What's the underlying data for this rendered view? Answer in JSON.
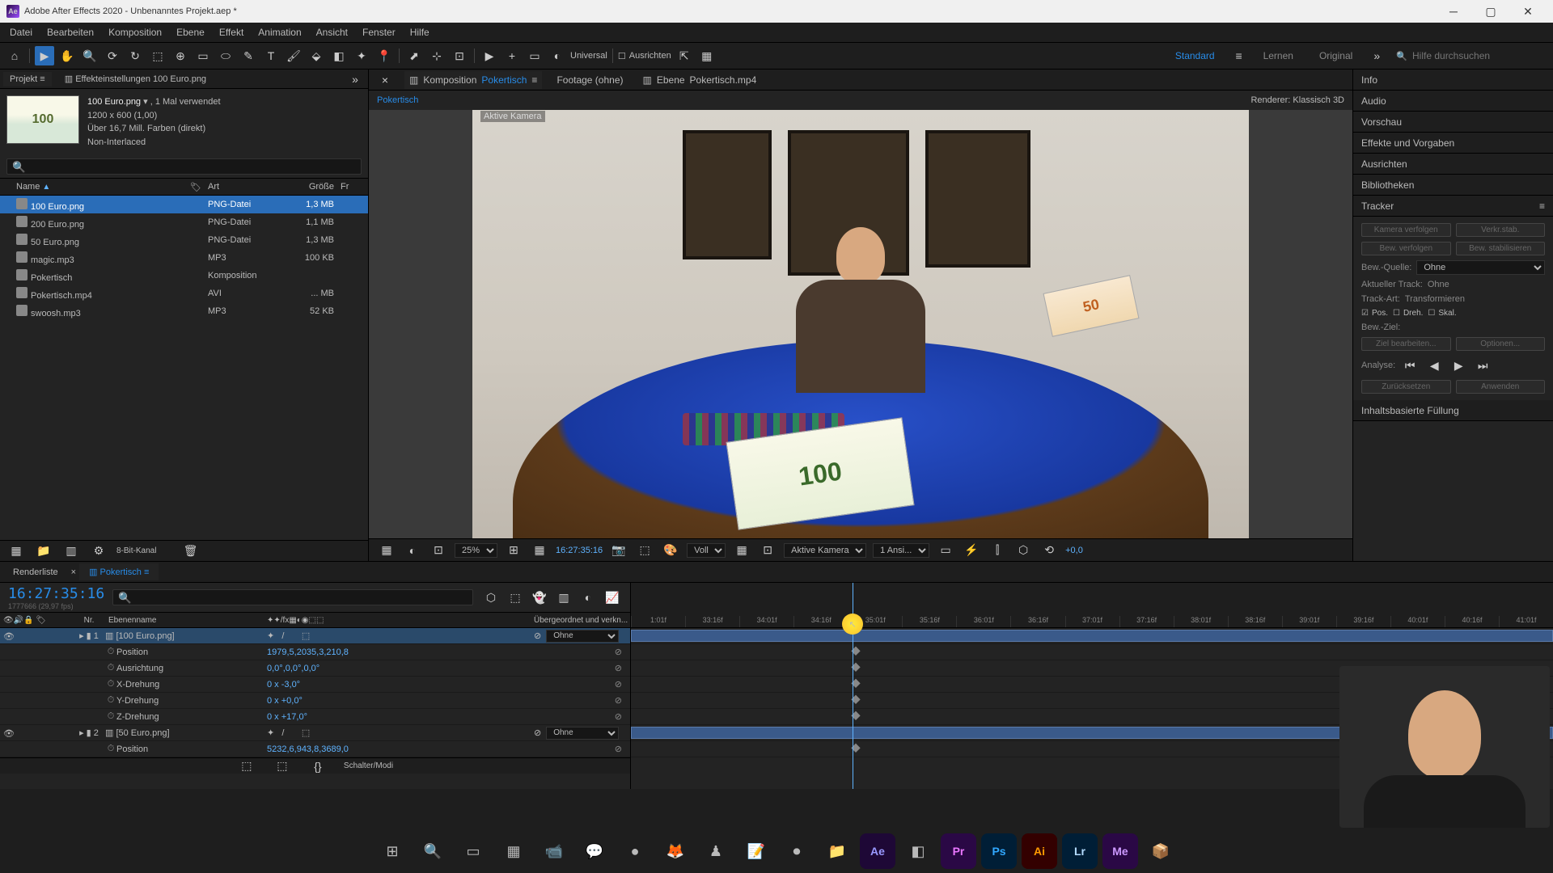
{
  "titlebar": {
    "app_icon": "Ae",
    "title": "Adobe After Effects 2020 - Unbenanntes Projekt.aep *"
  },
  "menu": [
    "Datei",
    "Bearbeiten",
    "Komposition",
    "Ebene",
    "Effekt",
    "Animation",
    "Ansicht",
    "Fenster",
    "Hilfe"
  ],
  "toolbar": {
    "snapping": "Ausrichten",
    "universal": "Universal",
    "workspaces": [
      "Standard",
      "Lernen",
      "Original"
    ],
    "search_placeholder": "Hilfe durchsuchen"
  },
  "project": {
    "tab_project": "Projekt",
    "tab_effect": "Effekteinstellungen 100 Euro.png",
    "asset": {
      "name": "100 Euro.png",
      "usage": "1 Mal verwendet",
      "dims": "1200 x 600 (1,00)",
      "colors": "Über 16,7 Mill. Farben (direkt)",
      "interlace": "Non-Interlaced"
    },
    "search_placeholder": "",
    "columns": {
      "name": "Name",
      "art": "Art",
      "size": "Größe",
      "fr": "Fr"
    },
    "rows": [
      {
        "name": "100 Euro.png",
        "art": "PNG-Datei",
        "size": "1,3 MB",
        "selected": true,
        "marq": true
      },
      {
        "name": "200 Euro.png",
        "art": "PNG-Datei",
        "size": "1,1 MB"
      },
      {
        "name": "50 Euro.png",
        "art": "PNG-Datei",
        "size": "1,3 MB"
      },
      {
        "name": "magic.mp3",
        "art": "MP3",
        "size": "100 KB"
      },
      {
        "name": "Pokertisch",
        "art": "Komposition",
        "size": ""
      },
      {
        "name": "Pokertisch.mp4",
        "art": "AVI",
        "size": "... MB"
      },
      {
        "name": "swoosh.mp3",
        "art": "MP3",
        "size": "52 KB"
      }
    ],
    "footer": {
      "depth": "8-Bit-Kanal"
    }
  },
  "comp": {
    "tab_comp_prefix": "Komposition",
    "tab_comp_name": "Pokertisch",
    "tab_footage": "Footage (ohne)",
    "tab_layer_prefix": "Ebene",
    "tab_layer_name": "Pokertisch.mp4",
    "breadcrumb": "Pokertisch",
    "renderer_label": "Renderer:",
    "renderer_value": "Klassisch 3D",
    "camera_label": "Aktive Kamera",
    "euro100": "100",
    "euro50": "50",
    "controls": {
      "zoom": "25%",
      "timecode": "16:27:35:16",
      "resolution": "Voll",
      "camera": "Aktive Kamera",
      "views": "1 Ansi...",
      "exposure": "+0,0"
    }
  },
  "right_panels": {
    "info": "Info",
    "audio": "Audio",
    "preview": "Vorschau",
    "effects": "Effekte und Vorgaben",
    "align": "Ausrichten",
    "libraries": "Bibliotheken",
    "tracker": "Tracker",
    "content_fill": "Inhaltsbasierte Füllung",
    "tracker_body": {
      "btn_track_camera": "Kamera verfolgen",
      "btn_warp": "Verkr.stab.",
      "btn_track_motion": "Bew. verfolgen",
      "btn_stabilize": "Bew. stabilisieren",
      "source_label": "Bew.-Quelle:",
      "source_value": "Ohne",
      "current_track_label": "Aktueller Track:",
      "current_track_value": "Ohne",
      "track_type_label": "Track-Art:",
      "track_type_value": "Transformieren",
      "check_pos": "Pos.",
      "check_rot": "Dreh.",
      "check_scale": "Skal.",
      "target_label": "Bew.-Ziel:",
      "btn_edit_target": "Ziel bearbeiten...",
      "btn_options": "Optionen...",
      "analyze_label": "Analyse:",
      "btn_reset": "Zurücksetzen",
      "btn_apply": "Anwenden"
    }
  },
  "timeline": {
    "tab_render": "Renderliste",
    "tab_comp": "Pokertisch",
    "timecode": "16:27:35:16",
    "frames": "1777666 (29,97 fps)",
    "col_head": {
      "a": "",
      "nr": "Nr.",
      "name": "Ebenenname",
      "parent": "Übergeordnet und verkn..."
    },
    "ruler": [
      "1:01f",
      "33:16f",
      "34:01f",
      "34:16f",
      "35:01f",
      "35:16f",
      "36:01f",
      "36:16f",
      "37:01f",
      "37:16f",
      "38:01f",
      "38:16f",
      "39:01f",
      "39:16f",
      "40:01f",
      "40:16f",
      "41:01f"
    ],
    "playhead_cursor": "↖",
    "layers": [
      {
        "nr": "1",
        "name": "[100 Euro.png]",
        "parent": "Ohne",
        "selected": true,
        "props": [
          {
            "name": "Position",
            "value": "1979,5,2035,3,210,8"
          },
          {
            "name": "Ausrichtung",
            "value": "0,0°,0,0°,0,0°"
          },
          {
            "name": "X-Drehung",
            "value": "0 x -3,0°"
          },
          {
            "name": "Y-Drehung",
            "value": "0 x +0,0°"
          },
          {
            "name": "Z-Drehung",
            "value": "0 x +17,0°"
          }
        ]
      },
      {
        "nr": "2",
        "name": "[50 Euro.png]",
        "parent": "Ohne",
        "props": [
          {
            "name": "Position",
            "value": "5232,6,943,8,3689,0"
          }
        ]
      }
    ],
    "footer_mode": "Schalter/Modi"
  },
  "taskbar": {
    "apps": [
      "⊞",
      "🔍",
      "▭",
      "▦",
      "📹",
      "💬",
      "●",
      "🦊",
      "♟",
      "📝",
      "⏺",
      "📁"
    ],
    "adobe": [
      "Ae",
      "◧",
      "Pr",
      "Ps",
      "Ai",
      "Lr",
      "Me",
      "📦"
    ]
  }
}
